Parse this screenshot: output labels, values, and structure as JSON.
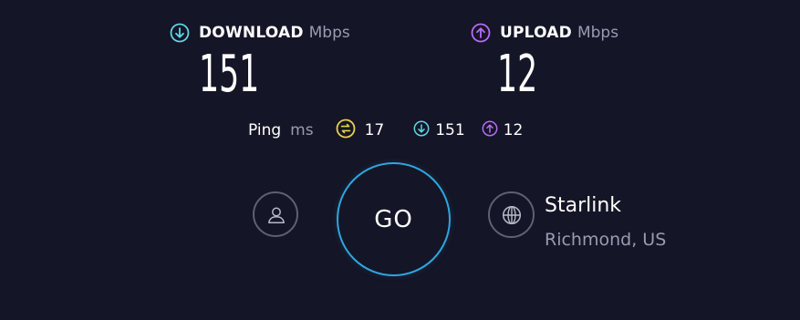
{
  "download": {
    "label": "DOWNLOAD",
    "unit": "Mbps",
    "value": "151",
    "icon": "download-arrow-icon",
    "color": "#5fd6e6"
  },
  "upload": {
    "label": "UPLOAD",
    "unit": "Mbps",
    "value": "12",
    "icon": "upload-arrow-icon",
    "color": "#b86bf5"
  },
  "ping": {
    "label": "Ping",
    "unit": "ms",
    "idle_value": "17",
    "download_value": "151",
    "upload_value": "12",
    "idle_color": "#e8d24a"
  },
  "go_button": {
    "label": "GO",
    "ring_color": "#2fa6e0"
  },
  "server": {
    "name": "Starlink",
    "location": "Richmond, US",
    "icon": "globe-icon"
  },
  "profile": {
    "icon": "user-icon"
  }
}
